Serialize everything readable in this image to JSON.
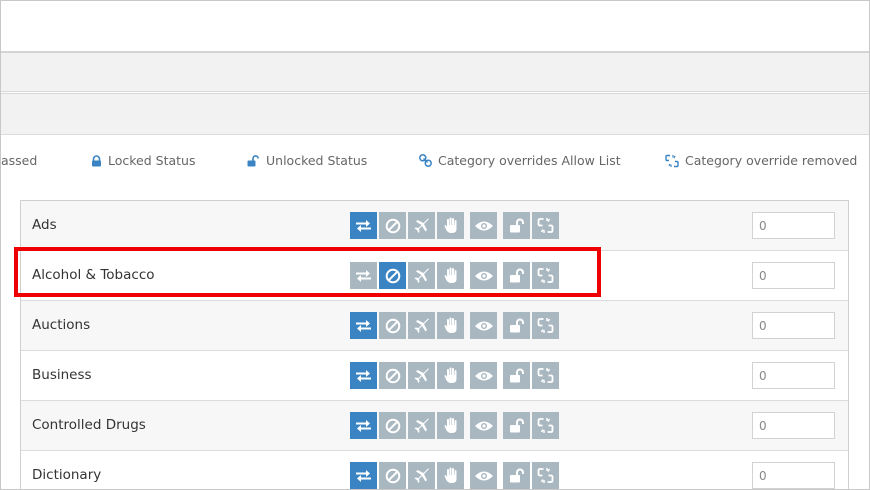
{
  "legend": {
    "bypassed": "assed",
    "locked": "Locked Status",
    "unlocked": "Unlocked Status",
    "overrides": "Category overrides Allow List",
    "removed": "Category override removed"
  },
  "action_icons": [
    "swap-arrows-icon",
    "block-icon",
    "airplane-icon",
    "hand-stop-icon",
    "eye-icon",
    "unlock-icon",
    "broken-link-icon"
  ],
  "colors": {
    "active": "#3a84c3",
    "inactive": "#a9b7c1",
    "highlight": "#ee0000"
  },
  "categories": [
    {
      "name": "Ads",
      "active": "swap",
      "count": "0"
    },
    {
      "name": "Alcohol & Tobacco",
      "active": "block",
      "count": "0"
    },
    {
      "name": "Auctions",
      "active": "swap",
      "count": "0"
    },
    {
      "name": "Business",
      "active": "swap",
      "count": "0"
    },
    {
      "name": "Controlled Drugs",
      "active": "swap",
      "count": "0"
    },
    {
      "name": "Dictionary",
      "active": "swap",
      "count": "0"
    }
  ]
}
